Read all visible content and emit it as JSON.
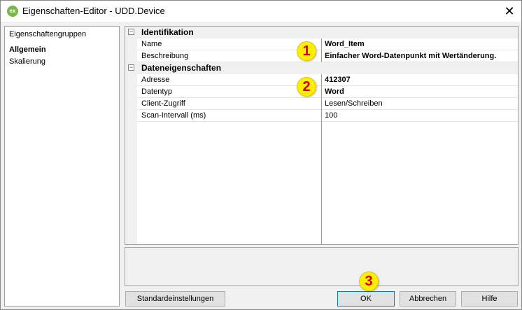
{
  "window": {
    "title": "Eigenschaften-Editor - UDD.Device",
    "icon_text": "ex",
    "close_glyph": "✕"
  },
  "left_panel": {
    "header": "Eigenschaftengruppen",
    "items": [
      {
        "label": "Allgemein",
        "active": true
      },
      {
        "label": "Skalierung",
        "active": false
      }
    ]
  },
  "property_grid": {
    "categories": [
      {
        "label": "Identifikation",
        "toggle": "−",
        "properties": [
          {
            "name": "Name",
            "value": "Word_Item",
            "bold": true
          },
          {
            "name": "Beschreibung",
            "value": "Einfacher Word-Datenpunkt mit Wertänderung.",
            "bold": true
          }
        ]
      },
      {
        "label": "Dateneigenschaften",
        "toggle": "−",
        "properties": [
          {
            "name": "Adresse",
            "value": "412307",
            "bold": true
          },
          {
            "name": "Datentyp",
            "value": "Word",
            "bold": true
          },
          {
            "name": "Client-Zugriff",
            "value": "Lesen/Schreiben",
            "bold": false
          },
          {
            "name": "Scan-Intervall (ms)",
            "value": "100",
            "bold": false
          }
        ]
      }
    ]
  },
  "buttons": {
    "defaults": "Standardeinstellungen",
    "ok": "OK",
    "cancel": "Abbrechen",
    "help": "Hilfe"
  },
  "badges": [
    "1",
    "2",
    "3"
  ],
  "colors": {
    "badge_fill": "#ffee00",
    "badge_text": "#d40000",
    "default_button_border": "#0078d7",
    "app_icon": "#7ab648"
  }
}
